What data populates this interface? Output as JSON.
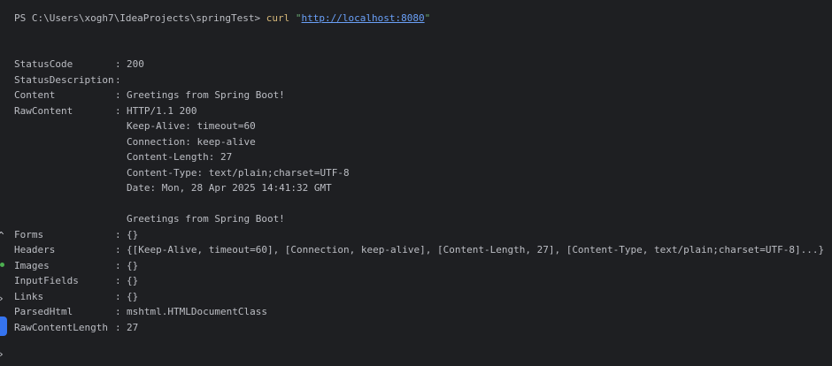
{
  "prompt": {
    "text": "PS C:\\Users\\xogh7\\IdeaProjects\\springTest> ",
    "command": "curl",
    "quote_open": " \"",
    "url": "http://localhost:8080",
    "quote_close": "\""
  },
  "output": {
    "status_code_label": "StatusCode",
    "status_code_value": "200",
    "status_description_label": "StatusDescription",
    "status_description_value": "",
    "content_label": "Content",
    "content_value": "Greetings from Spring Boot!",
    "raw_content_label": "RawContent",
    "raw_content_lines": [
      "HTTP/1.1 200",
      "Keep-Alive: timeout=60",
      "Connection: keep-alive",
      "Content-Length: 27",
      "Content-Type: text/plain;charset=UTF-8",
      "Date: Mon, 28 Apr 2025 14:41:32 GMT",
      "",
      "Greetings from Spring Boot!"
    ],
    "forms_label": "Forms",
    "forms_value": "{}",
    "headers_label": "Headers",
    "headers_value": "{[Keep-Alive, timeout=60], [Connection, keep-alive], [Content-Length, 27], [Content-Type, text/plain;charset=UTF-8]...}",
    "images_label": "Images",
    "images_value": "{}",
    "input_fields_label": "InputFields",
    "input_fields_value": "{}",
    "links_label": "Links",
    "links_value": "{}",
    "parsed_html_label": "ParsedHtml",
    "parsed_html_value": "mshtml.HTMLDocumentClass",
    "raw_content_length_label": "RawContentLength",
    "raw_content_length_value": "27"
  },
  "separator": ":",
  "gutter": {
    "icons": [
      "chevron-up-icon",
      "chevron-right-icon",
      "terminal-tab-icon",
      "chevron-right-icon"
    ],
    "active_color": "#3574f0",
    "status_dot_color": "#4caf50"
  },
  "colors": {
    "background": "#1e1f22",
    "text": "#bcbec4",
    "command": "#d5b778",
    "url": "#6aa0f8",
    "string": "#6aab73"
  }
}
